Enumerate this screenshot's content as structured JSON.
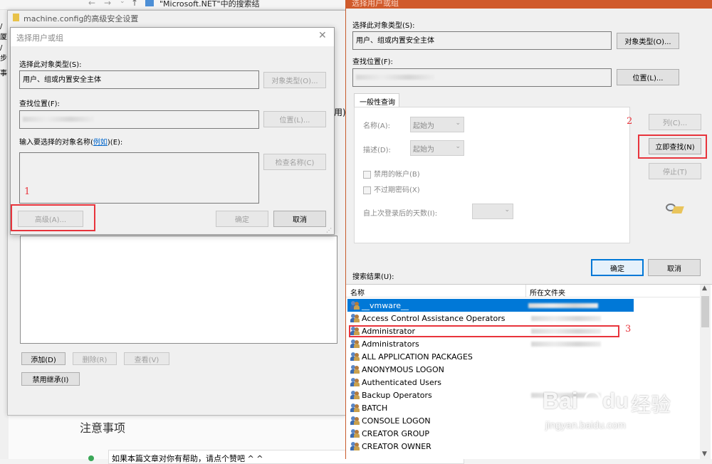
{
  "background": {
    "explorer_breadcrumb": "\"Microsoft.NET\"中的搜索结",
    "left_edge_chars": [
      "/厦",
      "/步",
      "事"
    ],
    "notes_heading": "注意事项",
    "notes_text": "如果本篇文章对你有帮助，请点个赞吧 ^ ^"
  },
  "security_dialog": {
    "title": "machine.config的高级安全设置",
    "add_label": "添加(D)",
    "remove_label": "删除(R)",
    "view_label": "查看(V)",
    "disable_inherit_label": "禁用继承(I)",
    "right_peek": "用)。"
  },
  "small_dialog": {
    "title": "选择用户或组",
    "object_type_label": "选择此对象类型(S):",
    "object_type_value": "用户、组或内置安全主体",
    "object_type_button": "对象类型(O)...",
    "location_label": "查找位置(F):",
    "location_button": "位置(L)...",
    "enter_names_label_pre": "输入要选择的对象名称(",
    "enter_names_link": "例如",
    "enter_names_label_post": ")(E):",
    "check_names_button": "检查名称(C)",
    "advanced_button": "高级(A)...",
    "ok_button": "确定",
    "cancel_button": "取消",
    "marker": "1"
  },
  "large_dialog": {
    "title": "选择用户或组",
    "object_type_label": "选择此对象类型(S):",
    "object_type_value": "用户、组或内置安全主体",
    "object_type_button": "对象类型(O)...",
    "location_label": "查找位置(F):",
    "location_button": "位置(L)...",
    "tab_general": "一般性查询",
    "name_label": "名称(A):",
    "name_combo": "起始为",
    "desc_label": "描述(D):",
    "desc_combo": "起始为",
    "disabled_accounts": "禁用的帐户(B)",
    "non_expiring_pwd": "不过期密码(X)",
    "days_since_login": "自上次登录后的天数(I):",
    "columns_button": "列(C)...",
    "find_now_button": "立即查找(N)",
    "stop_button": "停止(T)",
    "ok_button": "确定",
    "cancel_button": "取消",
    "results_label": "搜索结果(U):",
    "col_name": "名称",
    "col_folder": "所在文件夹",
    "marker_2": "2",
    "marker_3": "3",
    "results": [
      {
        "name": "__vmware__",
        "selected": true
      },
      {
        "name": "Access Control Assistance Operators"
      },
      {
        "name": "Administrator",
        "highlight": true
      },
      {
        "name": "Administrators"
      },
      {
        "name": "ALL APPLICATION PACKAGES"
      },
      {
        "name": "ANONYMOUS LOGON"
      },
      {
        "name": "Authenticated Users"
      },
      {
        "name": "Backup Operators"
      },
      {
        "name": "BATCH"
      },
      {
        "name": "CONSOLE LOGON"
      },
      {
        "name": "CREATOR GROUP"
      },
      {
        "name": "CREATOR OWNER"
      }
    ]
  },
  "watermark": {
    "brand": "Bai",
    "brand2": "du",
    "cn": "经验",
    "url": "jingyan.baidu.com"
  },
  "colors": {
    "accent": "#0078d7",
    "marker_red": "#e8343c",
    "title_bar_orange": "#d05a2b"
  }
}
